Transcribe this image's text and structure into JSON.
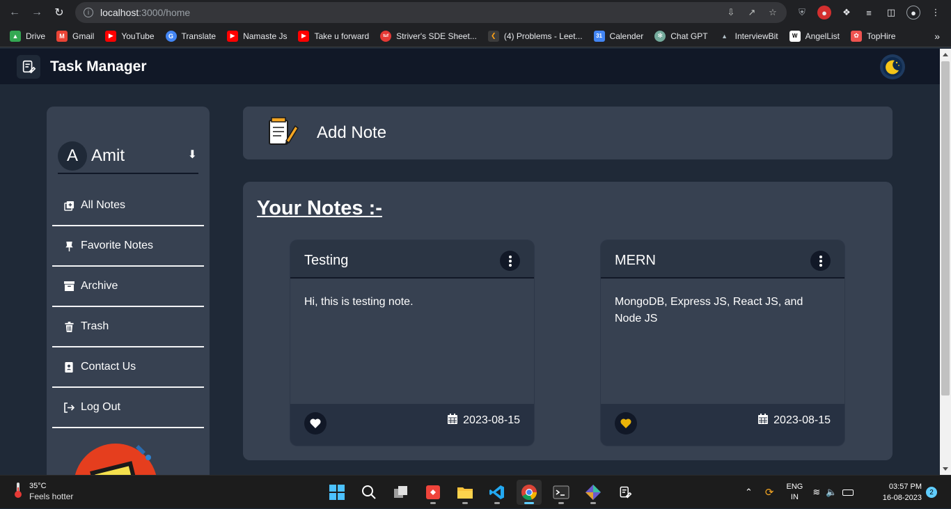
{
  "browser": {
    "url_host": "localhost",
    "url_path": ":3000/home",
    "bookmarks": [
      {
        "label": "Drive",
        "icon": "drive-icon",
        "color": "#34a853"
      },
      {
        "label": "Gmail",
        "icon": "gmail-icon",
        "color": "#ea4335"
      },
      {
        "label": "YouTube",
        "icon": "youtube-icon",
        "color": "#ff0000"
      },
      {
        "label": "Translate",
        "icon": "translate-icon",
        "color": "#4285f4"
      },
      {
        "label": "Namaste Js",
        "icon": "youtube-icon",
        "color": "#ff0000"
      },
      {
        "label": "Take u forward",
        "icon": "youtube-icon",
        "color": "#ff0000"
      },
      {
        "label": "Striver's SDE Sheet...",
        "icon": "tuf-icon",
        "color": "#e53935"
      },
      {
        "label": "(4) Problems - Leet...",
        "icon": "leetcode-icon",
        "color": "#ffa116"
      },
      {
        "label": "Calender",
        "icon": "calendar-icon",
        "color": "#4285f4"
      },
      {
        "label": "Chat GPT",
        "icon": "chatgpt-icon",
        "color": "#74aa9c"
      },
      {
        "label": "InterviewBit",
        "icon": "interviewbit-icon",
        "color": "#b0bec5"
      },
      {
        "label": "AngelList",
        "icon": "angellist-icon",
        "color": "#ffffff"
      },
      {
        "label": "TopHire",
        "icon": "tophire-icon",
        "color": "#ef5350"
      }
    ],
    "more": "»"
  },
  "app": {
    "title": "Task Manager",
    "user": {
      "initial": "A",
      "name": "Amit"
    },
    "menu": [
      {
        "label": "All Notes",
        "icon": "add-note-icon"
      },
      {
        "label": "Favorite Notes",
        "icon": "pin-icon"
      },
      {
        "label": "Archive",
        "icon": "archive-icon"
      },
      {
        "label": "Trash",
        "icon": "trash-icon"
      },
      {
        "label": "Contact Us",
        "icon": "contact-icon"
      },
      {
        "label": "Log Out",
        "icon": "logout-icon"
      }
    ],
    "add_note_label": "Add Note",
    "notes_heading": "Your Notes :-",
    "notes": [
      {
        "title": "Testing",
        "body": "Hi, this is testing note.",
        "date": "2023-08-15",
        "favorite": false
      },
      {
        "title": "MERN",
        "body": "MongoDB, Express JS, React JS, and Node JS",
        "date": "2023-08-15",
        "favorite": true
      }
    ],
    "colors": {
      "topbar": "#111827",
      "panel": "#374151",
      "page": "#1f2937",
      "favorite": "#eab308"
    }
  },
  "taskbar": {
    "temp": "35°C",
    "feel": "Feels hotter",
    "lang_top": "ENG",
    "lang_bottom": "IN",
    "time": "03:57 PM",
    "date": "16-08-2023",
    "notifications": "2"
  }
}
